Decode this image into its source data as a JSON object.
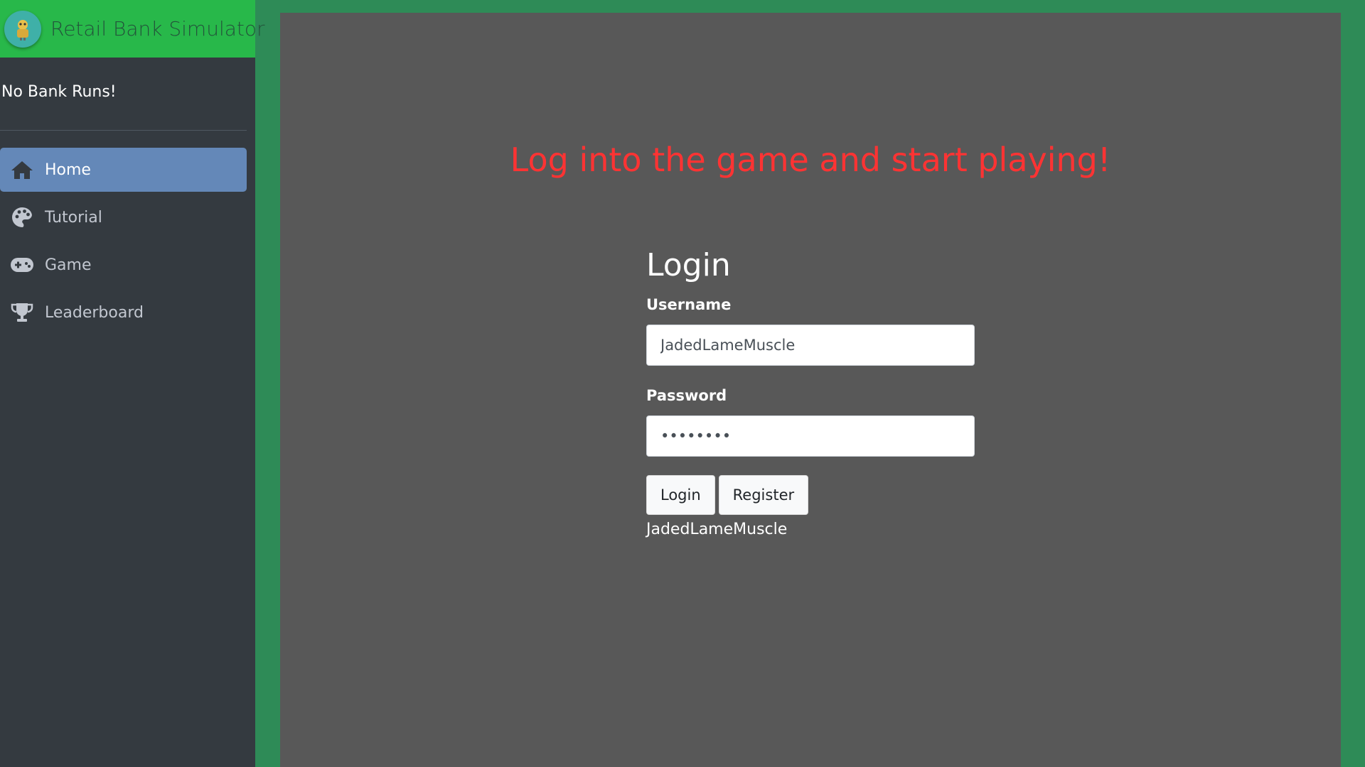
{
  "sidebar": {
    "brand": {
      "title": "Retail Bank Simulator",
      "logo_icon": "bank-mascot-icon"
    },
    "tagline": "No Bank Runs!",
    "items": [
      {
        "label": "Home",
        "icon": "home-icon",
        "active": true
      },
      {
        "label": "Tutorial",
        "icon": "palette-icon",
        "active": false
      },
      {
        "label": "Game",
        "icon": "gamepad-icon",
        "active": false
      },
      {
        "label": "Leaderboard",
        "icon": "trophy-icon",
        "active": false
      }
    ]
  },
  "main": {
    "headline": "Log into the game and start playing!",
    "login": {
      "title": "Login",
      "username_label": "Username",
      "username_value": "JadedLameMuscle",
      "password_label": "Password",
      "password_value": "••••••••",
      "login_button": "Login",
      "register_button": "Register",
      "user_echo": "JadedLameMuscle"
    }
  },
  "colors": {
    "page_bg": "#2e8b57",
    "brand_bg": "#28b84a",
    "sidebar_bg": "#343a40",
    "active_nav": "#6488b8",
    "panel_bg": "#585858",
    "headline": "#ff3333"
  }
}
